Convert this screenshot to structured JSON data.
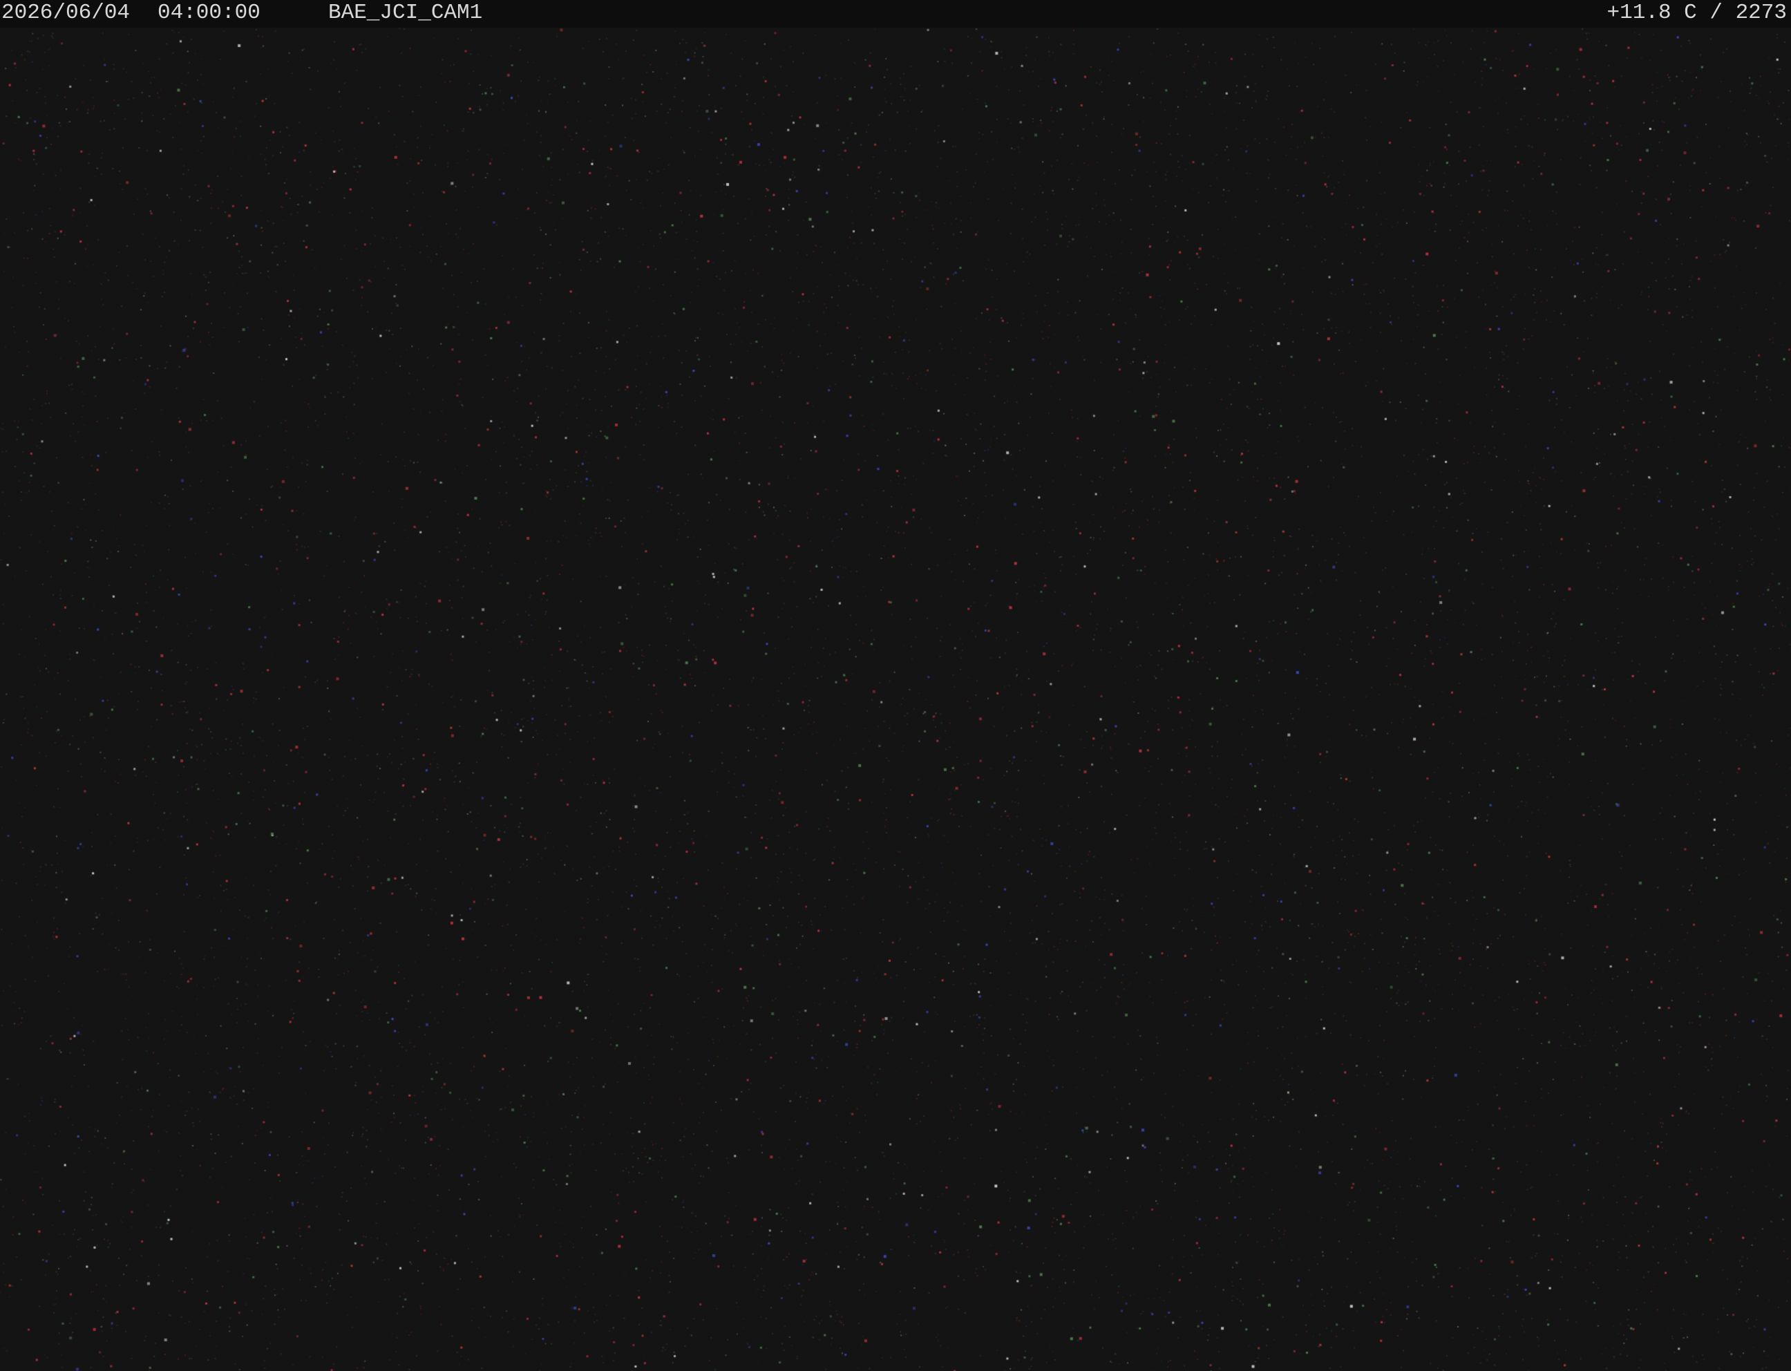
{
  "overlay": {
    "date": "2026/06/04",
    "time": "04:00:00",
    "camera_id": "BAE_JCI_CAM1",
    "sensor_readout": "+11.8 C / 2273"
  },
  "colors": {
    "background": "#141414",
    "header_background": "#0d0d0d",
    "overlay_text": "#d8d8d8",
    "star_red": "#b8323c",
    "star_green": "#4a7a4a",
    "star_blue": "#3a46b8",
    "star_white": "#c8c8c8"
  }
}
